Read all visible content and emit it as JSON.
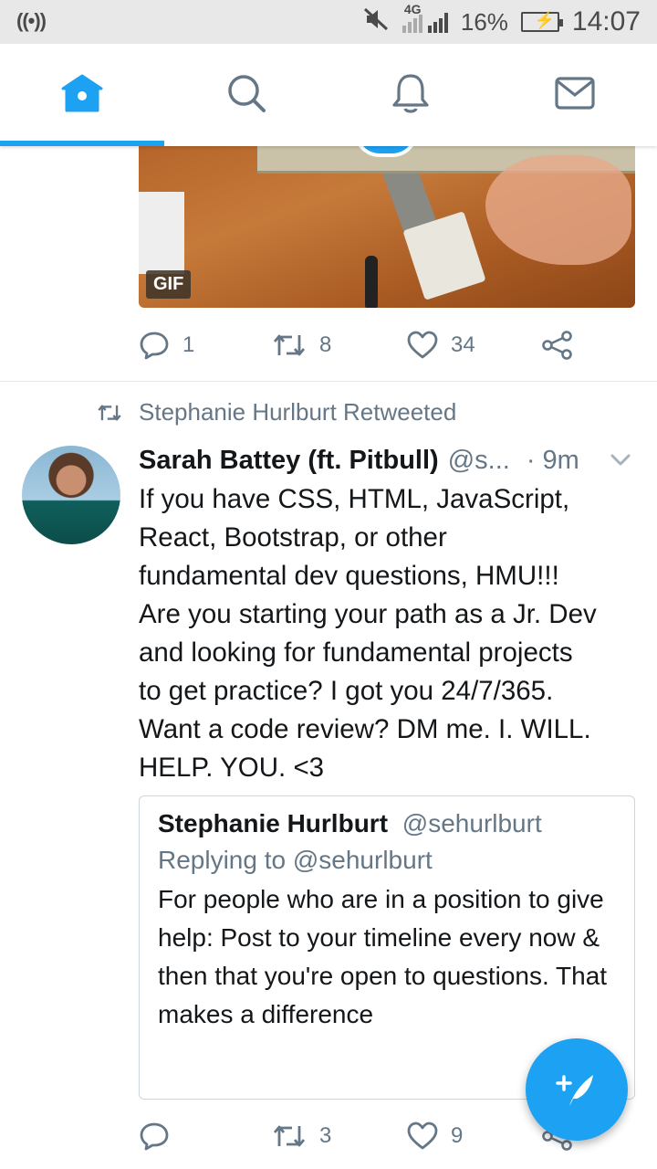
{
  "status_bar": {
    "left_icon": "hotspot-icon",
    "network": "4G",
    "battery": "16%",
    "time": "14:07"
  },
  "nav": {
    "tabs": [
      {
        "icon": "home-icon",
        "active": true
      },
      {
        "icon": "search-icon",
        "active": false
      },
      {
        "icon": "notifications-icon",
        "active": false
      },
      {
        "icon": "messages-icon",
        "active": false
      }
    ],
    "accent": "#1da1f2"
  },
  "tweet1": {
    "media_badge": "GIF",
    "actions": {
      "replies": "1",
      "retweets": "8",
      "likes": "34"
    }
  },
  "tweet2": {
    "retweeted_by": "Stephanie Hurlburt Retweeted",
    "name": "Sarah Battey (ft. Pitbull)",
    "handle": "@s...",
    "time": "· 9m",
    "text": "If you have CSS, HTML, JavaScript,\nReact, Bootstrap, or other\nfundamental dev questions, HMU!!!\nAre you starting your path as a Jr. Dev\nand looking for fundamental projects\nto get practice? I got you 24/7/365.\nWant a code review? DM me. I. WILL.\nHELP. YOU. <3",
    "quote": {
      "name": "Stephanie Hurlburt",
      "handle": "@sehurlburt",
      "replying_to": "Replying to @sehurlburt",
      "text": "For people who are in a position to give help: Post to your timeline every now & then that you're open to questions. That makes a difference"
    },
    "actions": {
      "replies": "",
      "retweets": "3",
      "likes": "9"
    }
  },
  "compose_button": {
    "icon": "compose-tweet-icon"
  }
}
